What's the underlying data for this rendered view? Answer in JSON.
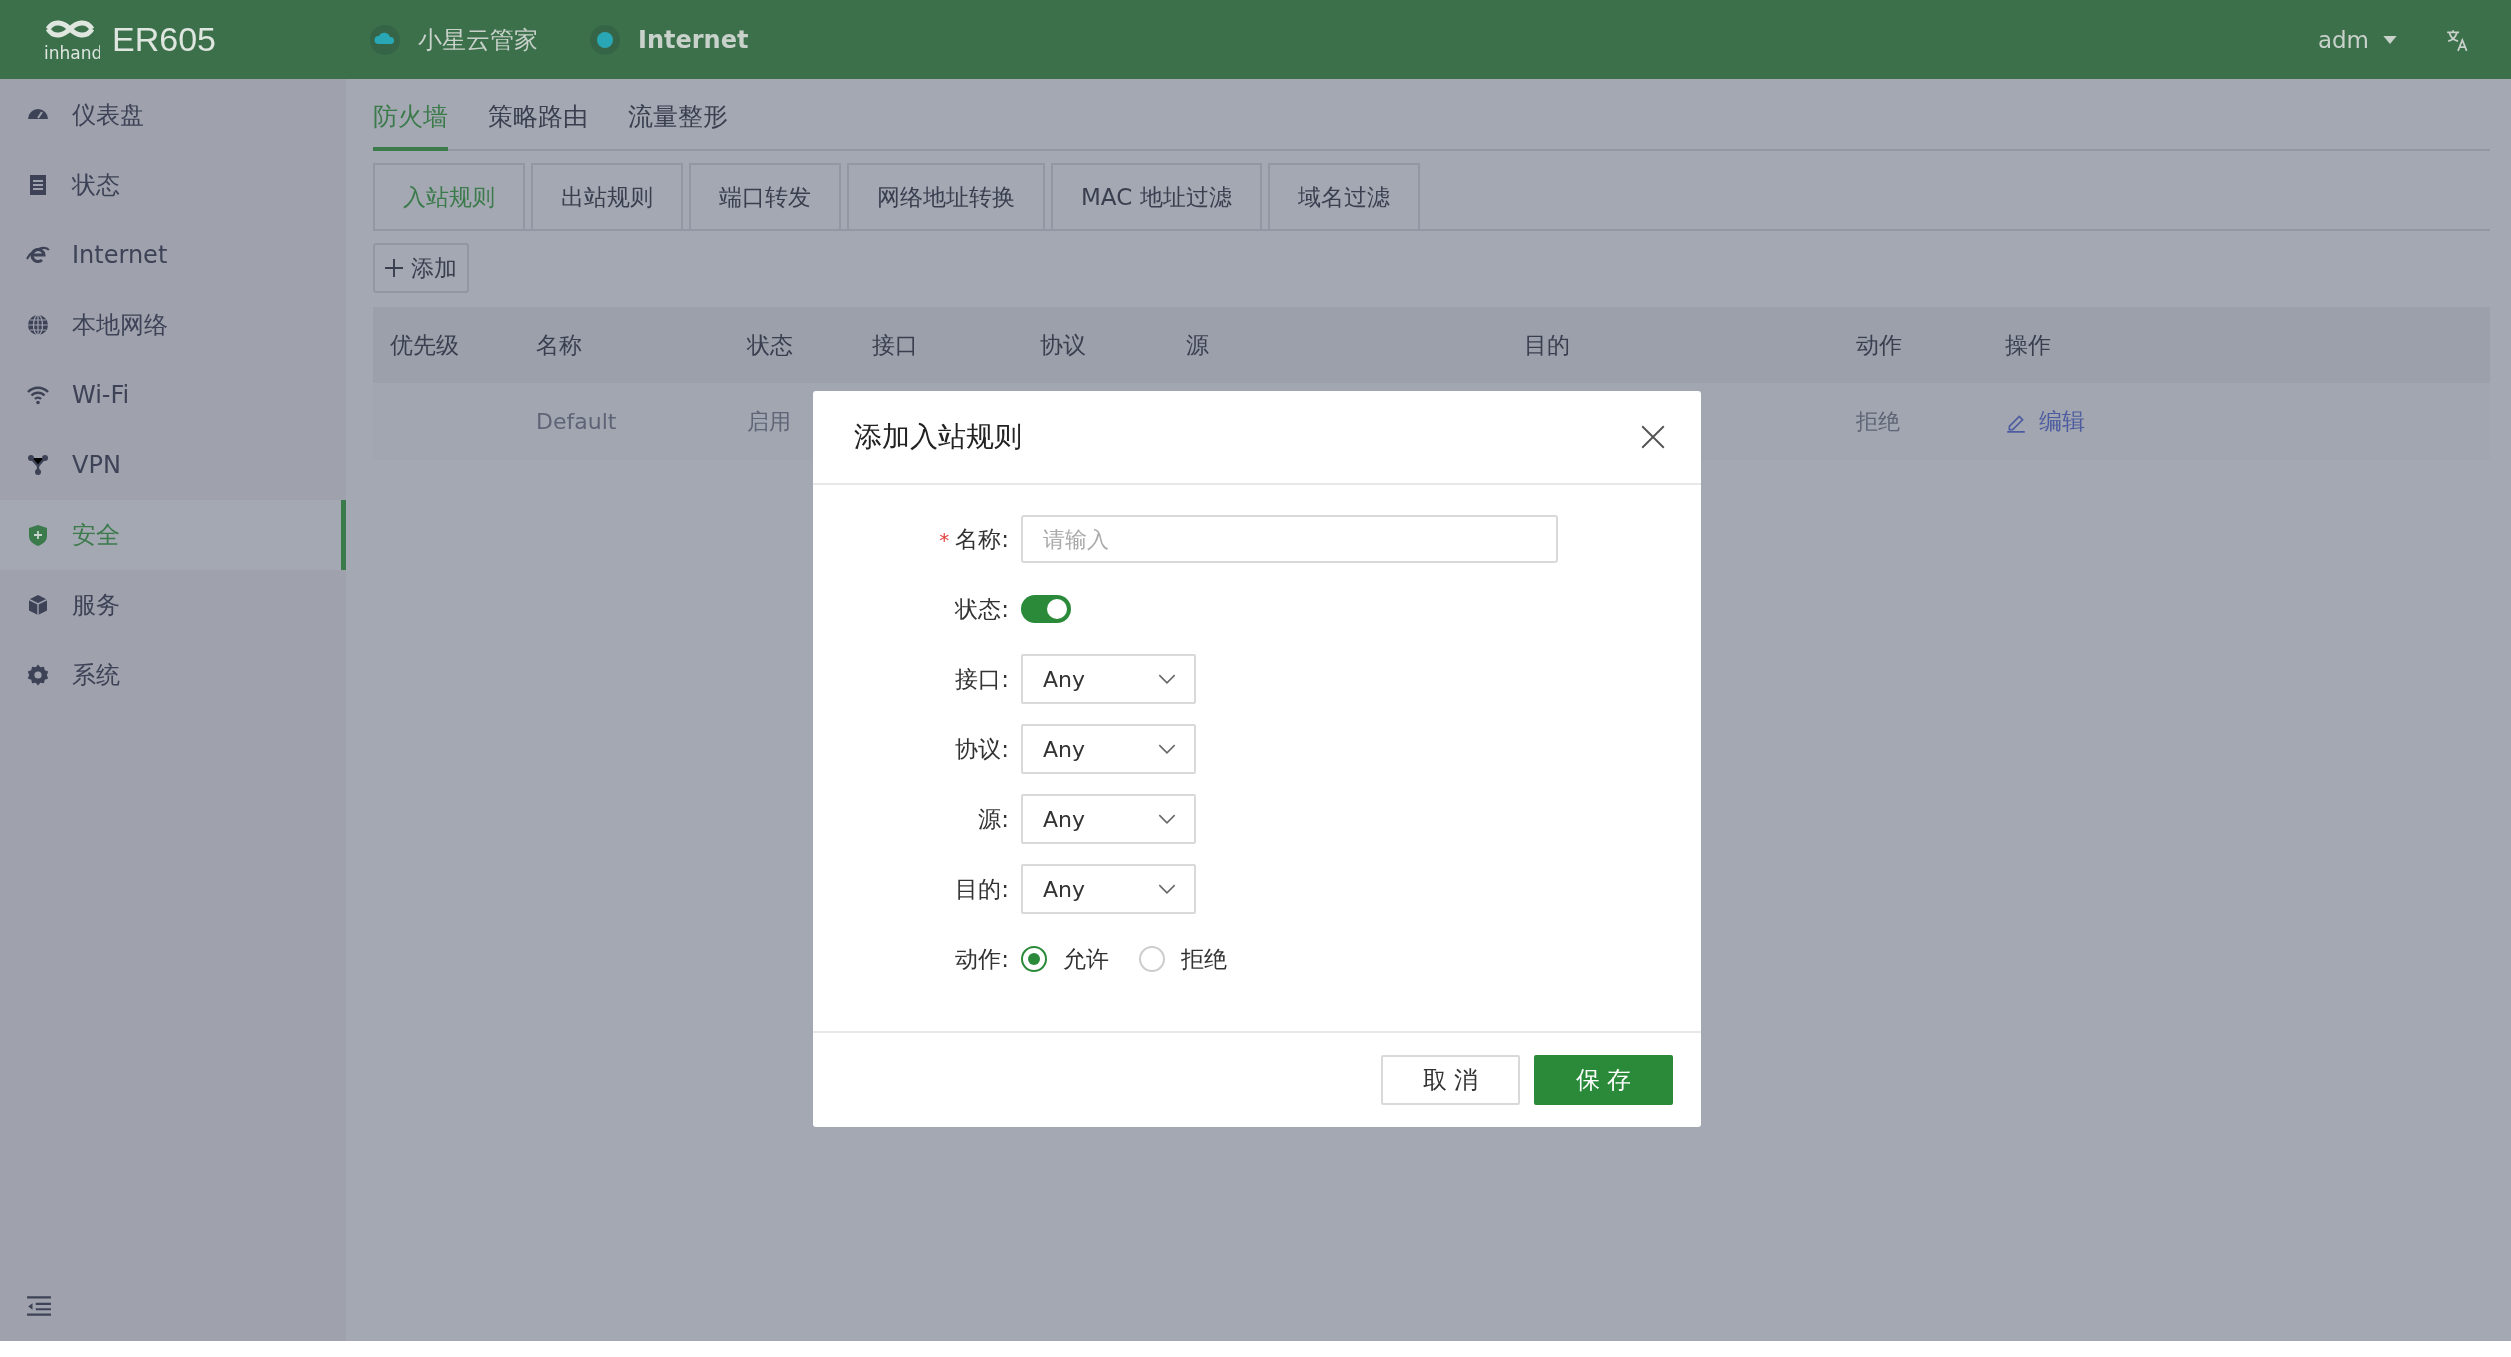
{
  "header": {
    "logo_text": "inhand",
    "brand": "ER605",
    "status_items": [
      {
        "label": "小星云管家"
      },
      {
        "label": "Internet"
      }
    ],
    "user": "adm"
  },
  "sidebar": {
    "items": [
      {
        "label": "仪表盘",
        "selected": false
      },
      {
        "label": "状态",
        "selected": false
      },
      {
        "label": "Internet",
        "selected": false
      },
      {
        "label": "本地网络",
        "selected": false
      },
      {
        "label": "Wi-Fi",
        "selected": false
      },
      {
        "label": "VPN",
        "selected": false
      },
      {
        "label": "安全",
        "selected": true
      },
      {
        "label": "服务",
        "selected": false
      },
      {
        "label": "系统",
        "selected": false
      }
    ]
  },
  "tabs": [
    {
      "label": "防火墙",
      "selected": true
    },
    {
      "label": "策略路由",
      "selected": false
    },
    {
      "label": "流量整形",
      "selected": false
    }
  ],
  "subtabs": [
    {
      "label": "入站规则",
      "selected": true
    },
    {
      "label": "出站规则",
      "selected": false
    },
    {
      "label": "端口转发",
      "selected": false
    },
    {
      "label": "网络地址转换",
      "selected": false
    },
    {
      "label": "MAC 地址过滤",
      "selected": false
    },
    {
      "label": "域名过滤",
      "selected": false
    }
  ],
  "add_button": "添加",
  "table": {
    "columns": [
      "优先级",
      "名称",
      "状态",
      "接口",
      "协议",
      "源",
      "目的",
      "动作",
      "操作"
    ],
    "rows": [
      {
        "name": "Default",
        "status": "启用",
        "action": "拒绝",
        "edit": "编辑"
      }
    ]
  },
  "dialog": {
    "title": "添加入站规则",
    "fields": [
      {
        "kind": "text",
        "label": "名称:",
        "required_mark": "*",
        "placeholder": "请输入"
      },
      {
        "kind": "switch",
        "label": "状态:",
        "on": true
      },
      {
        "kind": "select",
        "label": "接口:",
        "value": "Any"
      },
      {
        "kind": "select",
        "label": "协议:",
        "value": "Any"
      },
      {
        "kind": "select",
        "label": "源:",
        "value": "Any"
      },
      {
        "kind": "select",
        "label": "目的:",
        "value": "Any"
      },
      {
        "kind": "radio",
        "label": "动作:",
        "options": [
          {
            "label": "允许",
            "selected": true
          },
          {
            "label": "拒绝",
            "selected": false
          }
        ]
      }
    ],
    "buttons": [
      {
        "kind": "secondary",
        "label": "取 消"
      },
      {
        "kind": "primary",
        "label": "保 存"
      }
    ]
  }
}
